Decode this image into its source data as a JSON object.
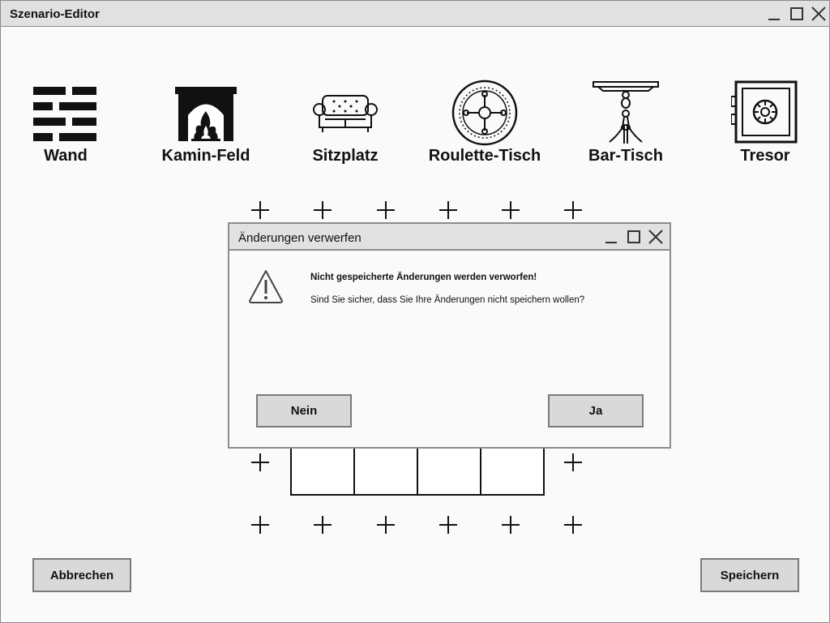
{
  "window": {
    "title": "Szenario-Editor"
  },
  "palette": [
    {
      "label": "Wand",
      "icon": "brick-wall-icon"
    },
    {
      "label": "Kamin-Feld",
      "icon": "fireplace-icon"
    },
    {
      "label": "Sitzplatz",
      "icon": "sofa-icon"
    },
    {
      "label": "Roulette-Tisch",
      "icon": "roulette-wheel-icon"
    },
    {
      "label": "Bar-Tisch",
      "icon": "bar-table-icon"
    },
    {
      "label": "Tresor",
      "icon": "safe-icon"
    }
  ],
  "footer": {
    "cancel_label": "Abbrechen",
    "save_label": "Speichern"
  },
  "dialog": {
    "title": "Änderungen verwerfen",
    "icon": "warning-icon",
    "message_strong": "Nicht gespeicherte Änderungen werden verworfen!",
    "message": "Sind Sie sicher, dass Sie Ihre Änderungen nicht speichern wollen?",
    "no_label": "Nein",
    "yes_label": "Ja"
  }
}
